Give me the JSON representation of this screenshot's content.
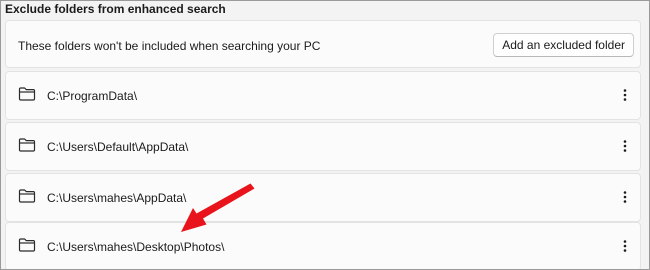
{
  "section": {
    "title": "Exclude folders from enhanced search"
  },
  "header": {
    "description": "These folders won't be included when searching your PC",
    "add_button_label": "Add an excluded folder"
  },
  "folders": [
    {
      "path": "C:\\ProgramData\\"
    },
    {
      "path": "C:\\Users\\Default\\AppData\\"
    },
    {
      "path": "C:\\Users\\mahes\\AppData\\"
    },
    {
      "path": "C:\\Users\\mahes\\Desktop\\Photos\\"
    }
  ],
  "icons": {
    "folder": "folder-icon",
    "more": "more-options-icon",
    "annotation": "red-arrow-icon"
  },
  "colors": {
    "annotation_arrow": "#e8131b"
  }
}
